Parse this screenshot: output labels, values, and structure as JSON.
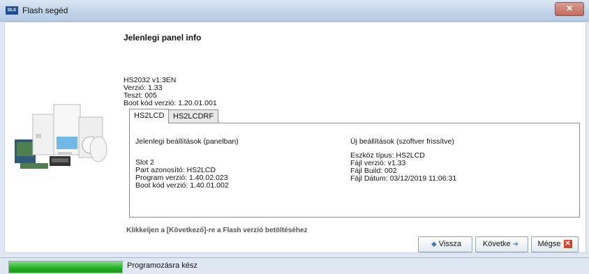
{
  "window": {
    "title": "Flash segéd",
    "app_icon_text": "DLS",
    "close_symbol": "✕"
  },
  "panel": {
    "heading": "Jelenlegi panel info",
    "info_lines": [
      "HS2032 v1.3EN",
      "Verzió: 1.33",
      "Teszt: 005",
      "Boot kód verzió: 1.20.01.001"
    ]
  },
  "tabs": [
    {
      "label": "HS2LCD",
      "active": true
    },
    {
      "label": "HS2LCDRF",
      "active": false
    }
  ],
  "current_settings": {
    "header": "Jelenlegi beállítások (panelban)",
    "lines": [
      "Slot 2",
      "Part azonosító: HS2LCD",
      "Program verzió: 1.40.02.023",
      "Boot kód verzió: 1.40.01.002"
    ]
  },
  "new_settings": {
    "header": "Új beállítások (szoftver frissítve)",
    "lines": [
      "Eszköz típus: HS2LCD",
      "Fájl verzió: v1.33",
      "Fájl Build: 002",
      "Fájl Dátum: 03/12/2019 11:06:31"
    ]
  },
  "hint": "Klikkeljen a [Következő]-re a Flash verzió betöltéséhez",
  "buttons": {
    "back": "Vissza",
    "next": "Követke",
    "cancel": "Mégse"
  },
  "icons": {
    "back": "arrow-left-icon",
    "next": "arrow-right-icon",
    "cancel": "red-x-icon"
  },
  "status": {
    "text": "Programozásra kész",
    "progress": 1.0
  },
  "colors": {
    "progress": "#22b122",
    "cancel_icon": "#d6452b",
    "arrow_icon": "#3a7bc8"
  }
}
